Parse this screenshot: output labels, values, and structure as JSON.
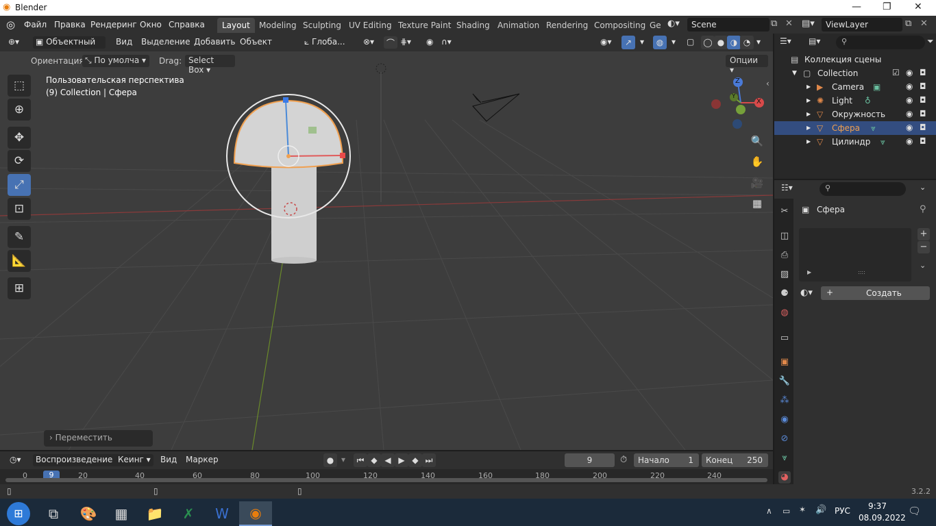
{
  "window": {
    "title": "Blender",
    "minimize": "—",
    "maximize": "❐",
    "close": "✕"
  },
  "menu": {
    "file": "Файл",
    "edit": "Правка",
    "render": "Рендеринг",
    "window": "Окно",
    "help": "Справка"
  },
  "workspaces": [
    "Layout",
    "Modeling",
    "Sculpting",
    "UV Editing",
    "Texture Paint",
    "Shading",
    "Animation",
    "Rendering",
    "Compositing",
    "Ge"
  ],
  "scene": {
    "name": "Scene",
    "view_layer": "ViewLayer"
  },
  "viewport_header": {
    "mode": "Объектный ...",
    "view": "Вид",
    "select": "Выделение",
    "add": "Добавить",
    "object": "Объект",
    "transform_orientation": "Глоба..."
  },
  "tool_settings": {
    "orientation_label": "Ориентация:",
    "orientation_value": "По умолча",
    "drag_label": "Drag:",
    "drag_value": "Select Box",
    "options": "Опции"
  },
  "viewport": {
    "view_name": "Пользовательская перспектива",
    "context": "(9) Collection | Сфера",
    "last_op": "Переместить",
    "gizmo_x": "X",
    "gizmo_y": "Y",
    "gizmo_z": "Z"
  },
  "outliner": {
    "root": "Коллекция сцены",
    "collection": "Collection",
    "items": [
      {
        "name": "Camera",
        "icon": "camera-icon",
        "color": "#e0884a",
        "selected": false
      },
      {
        "name": "Light",
        "icon": "light-icon",
        "color": "#e0884a",
        "selected": false
      },
      {
        "name": "Окружность",
        "icon": "mesh-icon",
        "color": "#e0884a",
        "selected": false
      },
      {
        "name": "Сфера",
        "icon": "mesh-icon",
        "color": "#f0a050",
        "selected": true
      },
      {
        "name": "Цилиндр",
        "icon": "mesh-icon",
        "color": "#e0884a",
        "selected": false
      }
    ]
  },
  "properties": {
    "object_name": "Сфера",
    "create_button": "Создать",
    "plus": "+",
    "minus": "−",
    "dots": "::::"
  },
  "timeline": {
    "playback": "Воспроизведение",
    "keying": "Кеинг",
    "view": "Вид",
    "marker": "Маркер",
    "current_frame": "9",
    "start_label": "Начало",
    "start_value": "1",
    "end_label": "Конец",
    "end_value": "250",
    "ruler": [
      "0",
      "9",
      "20",
      "40",
      "60",
      "80",
      "100",
      "120",
      "140",
      "160",
      "180",
      "200",
      "220",
      "240"
    ]
  },
  "status": {
    "version": "3.2.2"
  },
  "taskbar": {
    "lang": "РУС",
    "time": "9:37",
    "date": "08.09.2022"
  },
  "colors": {
    "accent": "#4772b3",
    "selection": "#f0a050",
    "x_axis": "#d84a4a",
    "y_axis": "#76a03a",
    "z_axis": "#4a7ad8"
  }
}
